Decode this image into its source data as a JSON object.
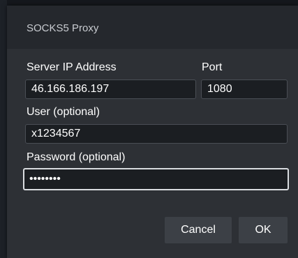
{
  "dialog": {
    "title": "SOCKS5 Proxy"
  },
  "form": {
    "server_ip_label": "Server IP Address",
    "server_ip_value": "46.166.186.197",
    "port_label": "Port",
    "port_value": "1080",
    "user_label": "User (optional)",
    "user_value": "x1234567",
    "password_label": "Password (optional)",
    "password_value": "passw0rd"
  },
  "buttons": {
    "cancel_label": "Cancel",
    "ok_label": "OK"
  },
  "colors": {
    "dialog_background": "#2d3035",
    "titlebar_background": "#25282d",
    "field_background": "#1b1e22",
    "button_background": "#3c4046",
    "focus_border": "#d9dce0"
  }
}
